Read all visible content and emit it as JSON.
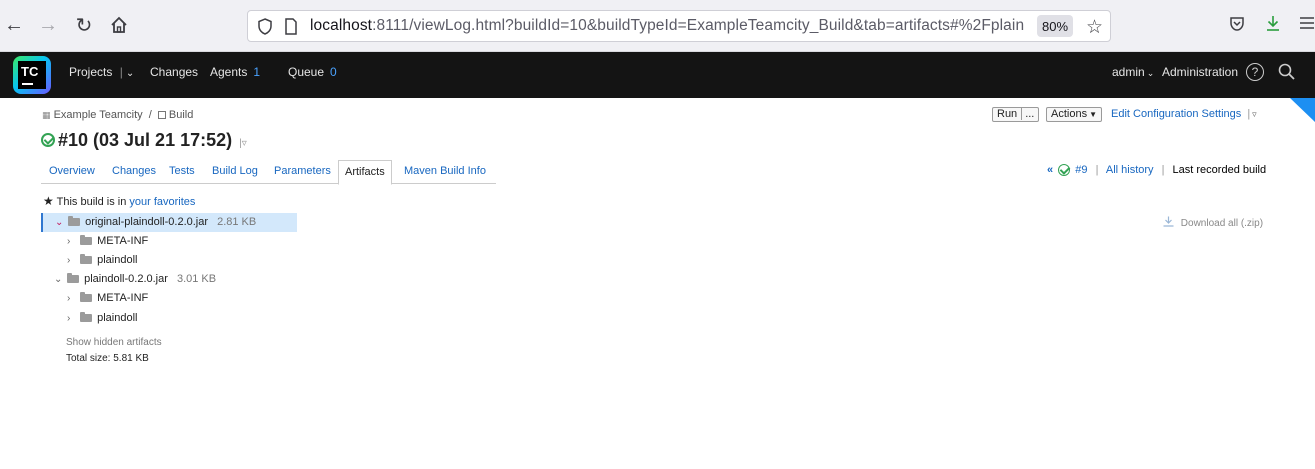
{
  "browser": {
    "url_host": "localhost",
    "url_rest": ":8111/viewLog.html?buildId=10&buildTypeId=ExampleTeamcity_Build&tab=artifacts#%2Fplain",
    "zoom": "80%"
  },
  "header": {
    "logo_text": "TC",
    "projects": "Projects",
    "changes": "Changes",
    "agents": "Agents",
    "agents_count": "1",
    "queue": "Queue",
    "queue_count": "0",
    "user": "admin",
    "administration": "Administration"
  },
  "breadcrumb": {
    "project": "Example Teamcity",
    "separator": "/",
    "build_config": "Build"
  },
  "actions": {
    "run": "Run",
    "run_more": "...",
    "actions": "Actions",
    "edit_config": "Edit Configuration Settings"
  },
  "build": {
    "title": "#10 (03 Jul 21 17:52)",
    "prev_build": "#9",
    "all_history": "All history",
    "last_recorded": "Last recorded build"
  },
  "tabs": [
    {
      "label": "Overview"
    },
    {
      "label": "Changes"
    },
    {
      "label": "Tests"
    },
    {
      "label": "Build Log"
    },
    {
      "label": "Parameters"
    },
    {
      "label": "Artifacts"
    },
    {
      "label": "Maven Build Info"
    }
  ],
  "favorites": {
    "prefix": "This build is in",
    "link": "your favorites"
  },
  "download_all": "Download all (.zip)",
  "artifacts": [
    {
      "name": "original-plaindoll-0.2.0.jar",
      "size": "2.81 KB",
      "children": [
        "META-INF",
        "plaindoll"
      ]
    },
    {
      "name": "plaindoll-0.2.0.jar",
      "size": "3.01 KB",
      "children": [
        "META-INF",
        "plaindoll"
      ]
    }
  ],
  "show_hidden": "Show hidden artifacts",
  "total_size": "Total size: 5.81 KB",
  "colors": {
    "header_bg": "#141414",
    "link": "#1867c0",
    "success": "#33a354",
    "selected_row": "#d3e8fb"
  }
}
